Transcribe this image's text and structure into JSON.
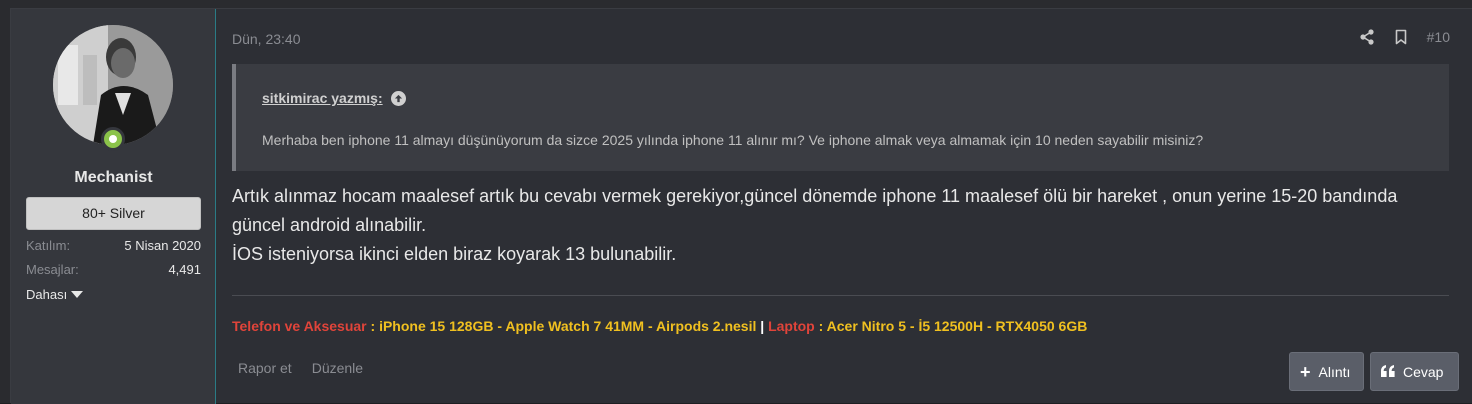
{
  "user": {
    "name": "Mechanist",
    "rank": "80+ Silver",
    "joined_label": "Katılım:",
    "joined_value": "5 Nisan 2020",
    "messages_label": "Mesajlar:",
    "messages_value": "4,491",
    "more_label": "Dahası",
    "online_color": "#8bc34a"
  },
  "post": {
    "date": "Dün, 23:40",
    "number": "#10",
    "quote": {
      "author": "sitkimirac yazmış:",
      "text": "Merhaba ben iphone 11 almayı düşünüyorum da sizce 2025 yılında iphone 11 alınır mı? Ve iphone almak veya almamak için 10 neden sayabilir misiniz?"
    },
    "body_line1": "Artık alınmaz hocam maalesef artık bu cevabı vermek gerekiyor,güncel dönemde iphone 11 maalesef ölü bir hareket , onun yerine 15-20 bandında güncel android alınabilir.",
    "body_line2": "İOS isteniyorsa ikinci elden biraz koyarak 13 bulunabilir."
  },
  "signature": {
    "cat1": "Telefon ve Aksesuar",
    "text1": " : iPhone 15 128GB - Apple Watch 7 41MM - Airpods 2.nesil ",
    "sep": "|",
    "cat2": " Laptop",
    "text2": " : Acer Nitro 5 - İ5 12500H - RTX4050 6GB"
  },
  "footer": {
    "report": "Rapor et",
    "edit": "Düzenle",
    "quote_btn": "Alıntı",
    "reply_btn": "Cevap"
  },
  "icons": {
    "share": "share-icon",
    "bookmark": "bookmark-icon",
    "quote_up": "arrow-up-circle-icon",
    "plus": "plus-icon",
    "reply": "quote-marks-icon"
  }
}
